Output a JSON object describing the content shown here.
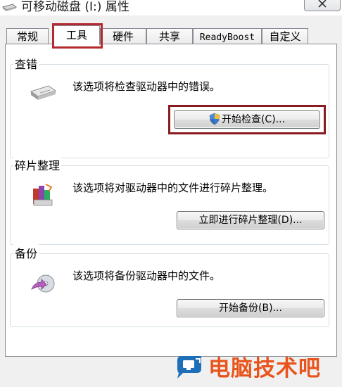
{
  "window": {
    "title": "可移动磁盘 (I:) 属性",
    "close_glyph": "X"
  },
  "tabs": [
    {
      "label": "常规",
      "active": false
    },
    {
      "label": "工具",
      "active": true
    },
    {
      "label": "硬件",
      "active": false
    },
    {
      "label": "共享",
      "active": false
    },
    {
      "label": "ReadyBoost",
      "active": false
    },
    {
      "label": "自定义",
      "active": false
    }
  ],
  "sections": {
    "error_check": {
      "title": "查错",
      "description": "该选项将检查驱动器中的错误。",
      "button": "开始检查(C)..."
    },
    "defrag": {
      "title": "碎片整理",
      "description": "该选项将对驱动器中的文件进行碎片整理。",
      "button": "立即进行碎片整理(D)..."
    },
    "backup": {
      "title": "备份",
      "description": "该选项将备份驱动器中的文件。",
      "button": "开始备份(B)..."
    }
  },
  "watermark": {
    "text": "电脑技术吧",
    "color": "#e8541c"
  },
  "colors": {
    "highlight_border": "#b4292f",
    "window_bg": "#f0f0f0"
  }
}
